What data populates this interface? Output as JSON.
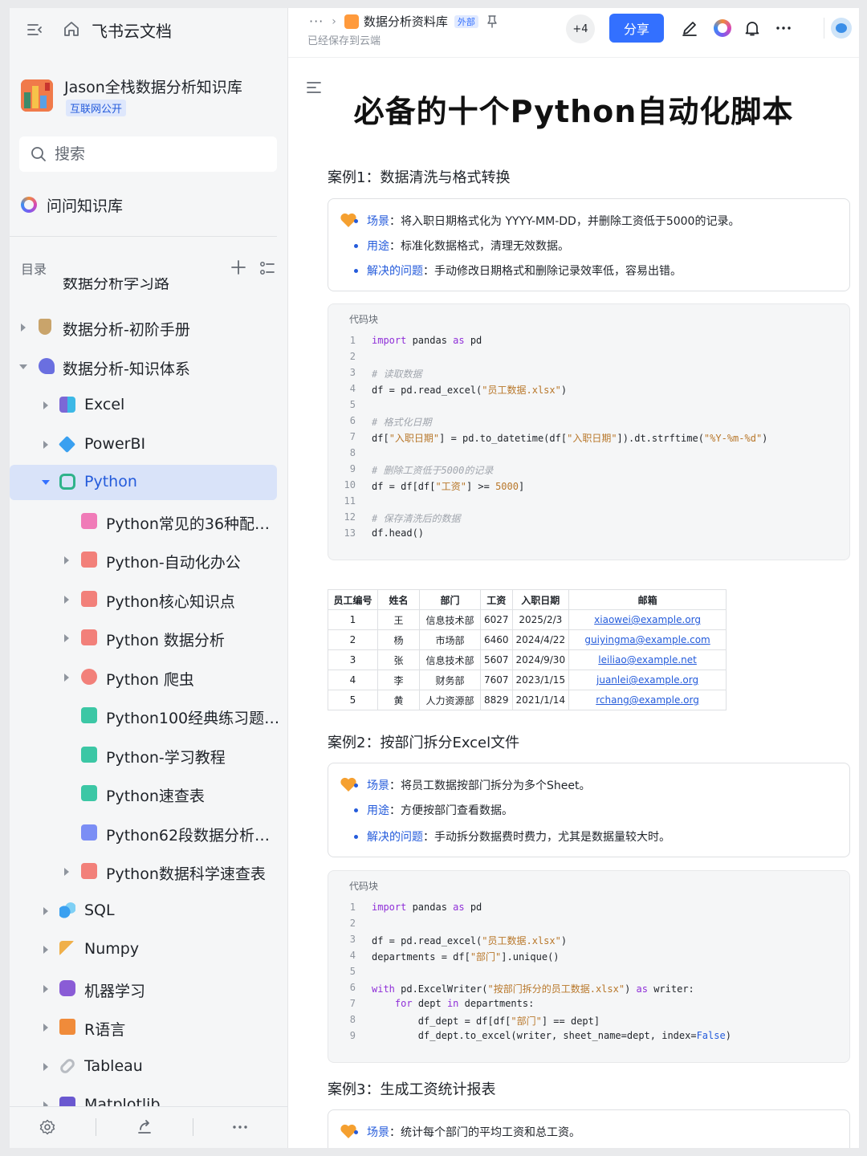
{
  "app": {
    "name": "飞书云文档"
  },
  "space": {
    "title": "Jason全栈数据分析知识库",
    "badge": "互联网公开"
  },
  "search": {
    "placeholder": "搜索"
  },
  "ask": {
    "label": "问问知识库"
  },
  "toc": {
    "label": "目录",
    "cut_item": "数据分析学习路线",
    "items": [
      {
        "label": "数据分析-初阶手册",
        "icon": "hourglass-icon",
        "color": "#c9a46b"
      },
      {
        "label": "数据分析-知识体系",
        "icon": "music-note-icon",
        "color": "#6a6fe0"
      },
      {
        "label": "Excel",
        "icon": "excel-icon",
        "color": "#7c68d6"
      },
      {
        "label": "PowerBI",
        "icon": "diamond-icon",
        "color": "#3aa0f0"
      },
      {
        "label": "Python",
        "icon": "python-icon",
        "color": "#2fb38a"
      },
      {
        "label": "Python常见的36种配图...",
        "icon": "doc-pink-icon",
        "color": "#f07bb8"
      },
      {
        "label": "Python-自动化办公",
        "icon": "doc-red-icon",
        "color": "#f2807a"
      },
      {
        "label": "Python核心知识点",
        "icon": "doc-red-icon",
        "color": "#f2807a"
      },
      {
        "label": "Python 数据分析",
        "icon": "doc-red-icon",
        "color": "#f2807a"
      },
      {
        "label": "Python 爬虫",
        "icon": "doc-red-icon",
        "color": "#f2807a"
      },
      {
        "label": "Python100经典练习题....",
        "icon": "doc-green-icon",
        "color": "#3cc7a5"
      },
      {
        "label": "Python-学习教程",
        "icon": "doc-green-icon",
        "color": "#3cc7a5"
      },
      {
        "label": "Python速查表",
        "icon": "doc-green-icon",
        "color": "#3cc7a5"
      },
      {
        "label": "Python62段数据分析和...",
        "icon": "doc-blue-icon",
        "color": "#7b8ef5"
      },
      {
        "label": "Python数据科学速查表",
        "icon": "doc-red-icon",
        "color": "#f2807a"
      },
      {
        "label": "SQL",
        "icon": "sql-icon",
        "color": "#3aa0f0"
      },
      {
        "label": "Numpy",
        "icon": "key-icon",
        "color": "#f0b04a"
      },
      {
        "label": "机器学习",
        "icon": "robot-icon",
        "color": "#8a5cd6"
      },
      {
        "label": "R语言",
        "icon": "r-icon",
        "color": "#f08b3a"
      },
      {
        "label": "Tableau",
        "icon": "link-icon",
        "color": "#a9aeb5"
      },
      {
        "label": "Matplotlib",
        "icon": "chart-icon",
        "color": "#6a58d0"
      }
    ]
  },
  "topbar": {
    "breadcrumb_ellipsis": "···",
    "breadcrumb_space": "数据分析资料库",
    "external_badge": "外部",
    "saved_status": "已经保存到云端",
    "collaborators": "+4",
    "share_label": "分享"
  },
  "doc": {
    "title": "必备的十个Python自动化脚本",
    "case1": {
      "heading": "案例1：数据清洗与格式转换",
      "bullets": [
        {
          "key": "场景",
          "text": "：将入职日期格式化为 YYYY-MM-DD，并删除工资低于5000的记录。"
        },
        {
          "key": "用途",
          "text": "：标准化数据格式，清理无效数据。"
        },
        {
          "key": "解决的问题",
          "text": "：手动修改日期格式和删除记录效率低，容易出错。"
        }
      ],
      "code_label": "代码块"
    },
    "table": {
      "headers": [
        "员工编号",
        "姓名",
        "部门",
        "工资",
        "入职日期",
        "邮箱"
      ],
      "rows": [
        [
          "1",
          "王",
          "信息技术部",
          "6027",
          "2025/2/3",
          "xiaowei@example.org"
        ],
        [
          "2",
          "杨",
          "市场部",
          "6460",
          "2024/4/22",
          "guiyingma@example.com"
        ],
        [
          "3",
          "张",
          "信息技术部",
          "5607",
          "2024/9/30",
          "leiliao@example.net"
        ],
        [
          "4",
          "李",
          "财务部",
          "7607",
          "2023/1/15",
          "juanlei@example.org"
        ],
        [
          "5",
          "黄",
          "人力资源部",
          "8829",
          "2021/1/14",
          "rchang@example.org"
        ]
      ]
    },
    "case2": {
      "heading": "案例2：按部门拆分Excel文件",
      "bullets": [
        {
          "key": "场景",
          "text": "：将员工数据按部门拆分为多个Sheet。"
        },
        {
          "key": "用途",
          "text": "：方便按部门查看数据。"
        },
        {
          "key": "解决的问题",
          "text": "：手动拆分数据费时费力，尤其是数据量较大时。"
        }
      ],
      "code_label": "代码块"
    },
    "case3": {
      "heading": "案例3：生成工资统计报表",
      "bullets": [
        {
          "key": "场景",
          "text": "：统计每个部门的平均工资和总工资。"
        }
      ]
    }
  }
}
